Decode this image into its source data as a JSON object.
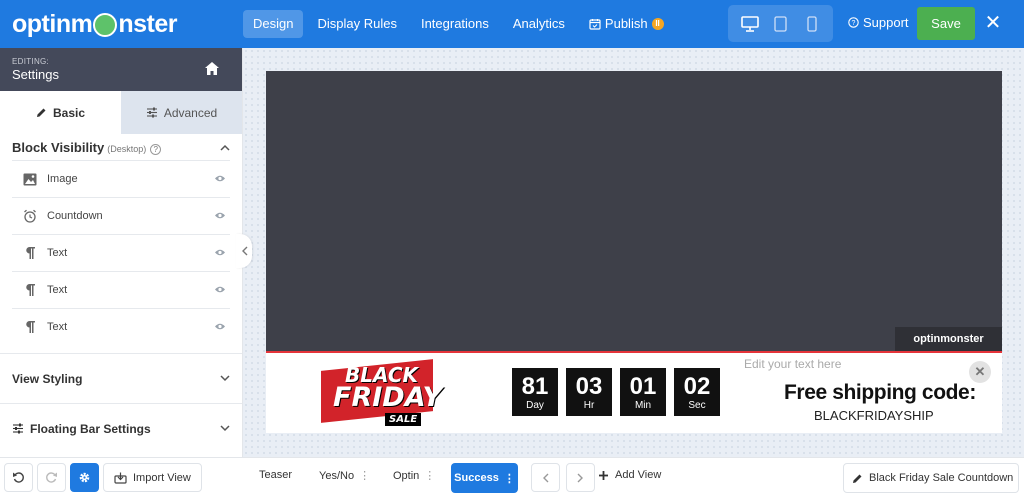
{
  "app": {
    "logo_text_left": "optinm",
    "logo_text_right": "nster"
  },
  "topnav": {
    "items": [
      {
        "label": "Design"
      },
      {
        "label": "Display Rules"
      },
      {
        "label": "Integrations"
      },
      {
        "label": "Analytics"
      },
      {
        "label": "Publish"
      }
    ],
    "publish_badge": "II",
    "devices": [
      "desktop-icon",
      "tablet-icon",
      "mobile-icon"
    ],
    "support_label": "Support",
    "save_label": "Save"
  },
  "sidebar": {
    "editing_label": "EDITING:",
    "editing_title": "Settings",
    "tabs": [
      {
        "label": "Basic"
      },
      {
        "label": "Advanced"
      }
    ],
    "block_visibility": {
      "title": "Block Visibility",
      "sub": "(Desktop)",
      "help": "?",
      "items": [
        {
          "label": "Image",
          "icon": "image-icon"
        },
        {
          "label": "Countdown",
          "icon": "alarm-clock-icon"
        },
        {
          "label": "Text",
          "icon": "paragraph-icon"
        },
        {
          "label": "Text",
          "icon": "paragraph-icon"
        },
        {
          "label": "Text",
          "icon": "paragraph-icon"
        }
      ]
    },
    "view_styling": "View Styling",
    "floating_bar_settings": "Floating Bar Settings",
    "import_view": "Import View"
  },
  "preview": {
    "badge": "optinmonster",
    "bf_logo": {
      "line1": "BLACK",
      "line2": "FRIDAY",
      "line3": "SALE"
    },
    "countdown": [
      {
        "value": "81",
        "label": "Day"
      },
      {
        "value": "03",
        "label": "Hr"
      },
      {
        "value": "01",
        "label": "Min"
      },
      {
        "value": "02",
        "label": "Sec"
      }
    ],
    "edit_hint": "Edit your text here",
    "shipping_title": "Free shipping code:",
    "shipping_code": "BLACKFRIDAYSHIP",
    "close": "✕"
  },
  "viewbar": {
    "teaser": "Teaser",
    "yesno": "Yes/No",
    "optin": "Optin",
    "success": "Success",
    "add_view": "Add View",
    "campaign_name": "Black Friday Sale Countdown"
  },
  "colors": {
    "brand_blue": "#1f7ae0",
    "save_green": "#4caf50",
    "sidebar_head": "#44495a"
  }
}
